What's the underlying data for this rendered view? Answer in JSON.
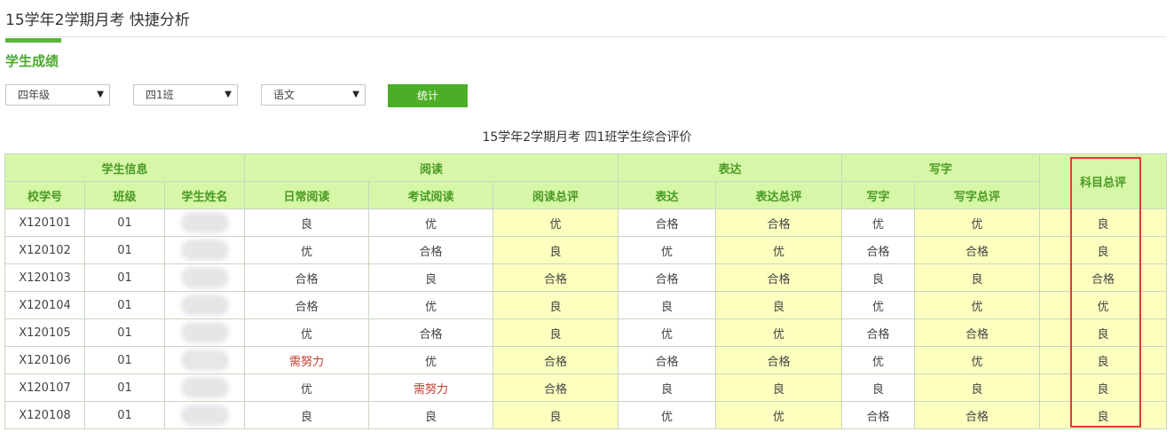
{
  "header": {
    "title": "15学年2学期月考  快捷分析"
  },
  "section": {
    "title": "学生成绩"
  },
  "filters": {
    "grade": "四年级",
    "class": "四1班",
    "subject": "语文",
    "button": "统计"
  },
  "table": {
    "caption": "15学年2学期月考  四1班学生综合评价",
    "groups": {
      "info": "学生信息",
      "reading": "阅读",
      "expression": "表达",
      "writing": "写字",
      "overall": "科目总评"
    },
    "columns": [
      "校学号",
      "班级",
      "学生姓名",
      "日常阅读",
      "考试阅读",
      "阅读总评",
      "表达",
      "表达总评",
      "写字",
      "写字总评"
    ],
    "rows": [
      [
        "X120101",
        "01",
        "",
        "良",
        "优",
        "优",
        "合格",
        "合格",
        "优",
        "优",
        "良"
      ],
      [
        "X120102",
        "01",
        "",
        "优",
        "合格",
        "良",
        "优",
        "优",
        "合格",
        "合格",
        "良"
      ],
      [
        "X120103",
        "01",
        "",
        "合格",
        "良",
        "合格",
        "合格",
        "合格",
        "良",
        "良",
        "合格"
      ],
      [
        "X120104",
        "01",
        "",
        "合格",
        "优",
        "良",
        "良",
        "良",
        "优",
        "优",
        "优"
      ],
      [
        "X120105",
        "01",
        "",
        "优",
        "合格",
        "良",
        "优",
        "优",
        "合格",
        "合格",
        "良"
      ],
      [
        "X120106",
        "01",
        "",
        "需努力",
        "优",
        "合格",
        "合格",
        "合格",
        "优",
        "优",
        "良"
      ],
      [
        "X120107",
        "01",
        "",
        "优",
        "需努力",
        "合格",
        "良",
        "良",
        "良",
        "良",
        "良"
      ],
      [
        "X120108",
        "01",
        "",
        "良",
        "良",
        "良",
        "优",
        "优",
        "合格",
        "合格",
        "良"
      ]
    ]
  },
  "colors": {
    "accent": "#4cae28",
    "header_bg": "#d7f7a8",
    "highlight_bg": "#fdffbf",
    "warning_text": "#c0392b",
    "frame": "#e03b3b"
  }
}
